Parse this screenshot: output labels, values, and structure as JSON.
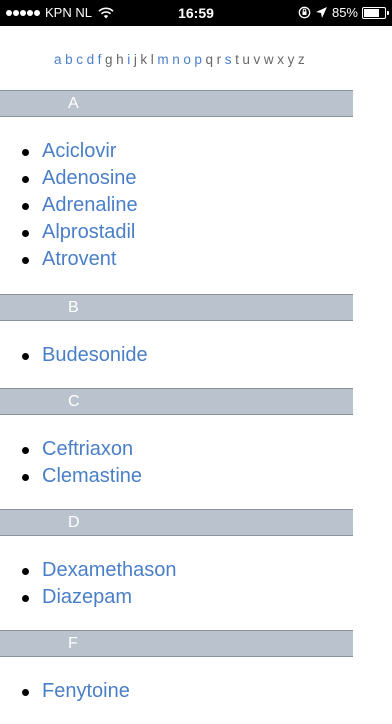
{
  "status_bar": {
    "carrier": "KPN NL",
    "time": "16:59",
    "battery": "85%",
    "battery_level": 0.85,
    "icons": [
      "signal-icon",
      "wifi-icon",
      "rotation-lock-icon",
      "location-icon",
      "battery-icon"
    ]
  },
  "alphabet": {
    "letters": [
      {
        "letter": "a",
        "link": true
      },
      {
        "letter": "b",
        "link": true
      },
      {
        "letter": "c",
        "link": true
      },
      {
        "letter": "d",
        "link": true
      },
      {
        "letter": "f",
        "link": true
      },
      {
        "letter": "g",
        "link": false
      },
      {
        "letter": "h",
        "link": false
      },
      {
        "letter": "i",
        "link": true
      },
      {
        "letter": "j",
        "link": false
      },
      {
        "letter": "k",
        "link": false
      },
      {
        "letter": "l",
        "link": false
      },
      {
        "letter": "m",
        "link": true
      },
      {
        "letter": "n",
        "link": true
      },
      {
        "letter": "o",
        "link": true
      },
      {
        "letter": "p",
        "link": true
      },
      {
        "letter": "q",
        "link": false
      },
      {
        "letter": "r",
        "link": false
      },
      {
        "letter": "s",
        "link": true
      },
      {
        "letter": "t",
        "link": false
      },
      {
        "letter": "u",
        "link": false
      },
      {
        "letter": "v",
        "link": false
      },
      {
        "letter": "w",
        "link": false
      },
      {
        "letter": "x",
        "link": false
      },
      {
        "letter": "y",
        "link": false
      },
      {
        "letter": "z",
        "link": false
      }
    ]
  },
  "sections": [
    {
      "header": "A",
      "items": [
        "Aciclovir",
        "Adenosine",
        "Adrenaline",
        "Alprostadil",
        "Atrovent"
      ]
    },
    {
      "header": "B",
      "items": [
        "Budesonide"
      ]
    },
    {
      "header": "C",
      "items": [
        "Ceftriaxon",
        "Clemastine"
      ]
    },
    {
      "header": "D",
      "items": [
        "Dexamethason",
        "Diazepam"
      ]
    },
    {
      "header": "F",
      "items": [
        "Fenytoine"
      ]
    }
  ],
  "colors": {
    "link": "#4a7fc8",
    "header_bg": "#b9c2cd",
    "header_text": "#ffffff"
  }
}
